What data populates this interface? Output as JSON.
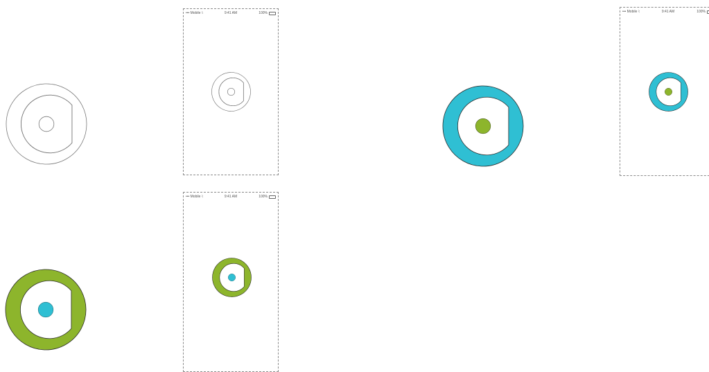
{
  "statusbar": {
    "carrier": "••• Mobile ⌇",
    "time": "9:41 AM",
    "battery": "100%",
    "battery_icon": "battery-icon"
  },
  "logo_variants": [
    {
      "name": "outline",
      "ring": "#ffffff",
      "dot": "#ffffff",
      "stroke": "#777777"
    },
    {
      "name": "teal",
      "ring": "#2fbfd3",
      "dot": "#8db52c",
      "stroke": "#2a2a2a"
    },
    {
      "name": "green",
      "ring": "#8db52c",
      "dot": "#2fbfd3",
      "stroke": "#2a2a2a"
    }
  ]
}
